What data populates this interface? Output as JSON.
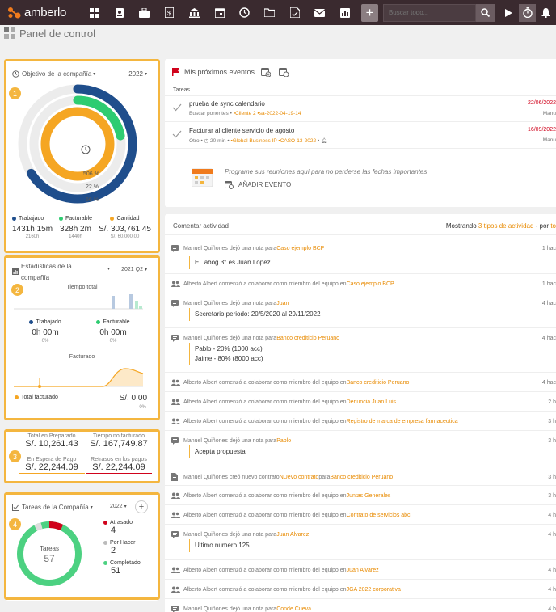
{
  "app": {
    "logo": "amberlo"
  },
  "topbar": {
    "search_placeholder": "Buscar todo...",
    "plus": "+",
    "icons": [
      "dashboard-icon",
      "contacts-icon",
      "briefcase-icon",
      "billing-icon",
      "bank-icon",
      "calendar-icon",
      "history-icon",
      "folder-icon",
      "document-icon",
      "mail-icon",
      "chart-icon"
    ]
  },
  "page": {
    "title": "Panel de control"
  },
  "objetivo": {
    "title": "Objetivo de la compañía",
    "year": "2022",
    "center_label": "",
    "pct": [
      "506 %",
      "22 %",
      "66 %"
    ],
    "legend": [
      {
        "label": "Trabajado",
        "value": "1431h 15m",
        "sub": "2160h",
        "color": "#1f4e8c"
      },
      {
        "label": "Facturable",
        "value": "328h 2m",
        "sub": "1440h",
        "color": "#2ecc71"
      },
      {
        "label": "Cantidad",
        "value": "S/. 303,761.45",
        "sub": "S/. 60,000.00",
        "color": "#f5a623"
      }
    ],
    "rings": {
      "trabajado": 0.66,
      "facturable": 0.22,
      "cantidad": 1.0
    }
  },
  "estadisticas": {
    "title_l1": "Estadísticas de la",
    "title_l2": "compañía",
    "period": "2021 Q2",
    "tiempo_total": "Tiempo total",
    "trabajado_label": "Trabajado",
    "trabajado_value": "0h 00m",
    "trabajado_pct": "0%",
    "facturable_label": "Facturable",
    "facturable_value": "0h 00m",
    "facturable_pct": "0%",
    "facturado": "Facturado",
    "total_facturado_label": "Total facturado",
    "total_facturado_value": "S/. 0.00",
    "total_facturado_pct": "0%"
  },
  "totales": [
    {
      "label": "Total en Preparado",
      "value": "S/. 10,261.43",
      "color": "#1f4e8c"
    },
    {
      "label": "Tiempo no facturado",
      "value": "S/. 167,749.87",
      "color": "#888"
    },
    {
      "label": "En Espera de Pago",
      "value": "S/. 22,244.09",
      "color": "#f5a623"
    },
    {
      "label": "Retrasos en los pagos",
      "value": "S/. 22,244.09",
      "color": "#d0021b"
    }
  ],
  "tareas": {
    "title": "Tareas de la Compañía",
    "year": "2022",
    "plus": "+",
    "center_label": "Tareas",
    "center_value": "57",
    "legend": [
      {
        "label": "Atrasado",
        "value": "4",
        "color": "#d0021b"
      },
      {
        "label": "Por Hacer",
        "value": "2",
        "color": "#bbb"
      },
      {
        "label": "Completado",
        "value": "51",
        "color": "#4cd181"
      }
    ]
  },
  "eventos": {
    "title": "Mis próximos eventos",
    "section": "Tareas",
    "items": [
      {
        "title": "prueba de sync calendario",
        "meta": "Buscar ponentes",
        "tag1": "Cliente 2",
        "tag2": "sa-2022-04-19-14",
        "date": "22/06/2022",
        "who": "Manu"
      },
      {
        "title": "Facturar al cliente servicio de agosto",
        "meta": "Otro",
        "dur": "20 min",
        "tag1": "Global Business IP",
        "tag2": "CASO-13-2022",
        "date": "16/09/2022",
        "who": "Manu"
      }
    ],
    "empty_text": "Programe sus reuniones aquí para no perderse las fechas importantes",
    "add_event": "AÑADIR EVENTO"
  },
  "actividad": {
    "title": "Comentar actividad",
    "showing_prefix": "Mostrando ",
    "showing_link": "3 tipos de actividad",
    "showing_suffix": " - por ",
    "showing_tail": "to",
    "rows": [
      {
        "pre": "Manuel Quiñones dejó una nota para ",
        "link": "Caso ejemplo BCP",
        "time": "1 hac",
        "icon": "note-icon"
      },
      {
        "pre": "Alberto Albert comenzó a colaborar como miembro del equipo en ",
        "link": "Caso ejemplo BCP",
        "time": "1 hac",
        "icon": "team-icon"
      },
      {
        "pre": "Manuel Quiñones dejó una nota para ",
        "link": "Juan",
        "time": "4 hac",
        "icon": "note-icon"
      },
      {
        "pre": "Manuel Quiñones dejó una nota para ",
        "link": "Banco crediticio Peruano",
        "time": "4 hac",
        "icon": "note-icon"
      },
      {
        "pre": "Alberto Albert comenzó a colaborar como miembro del equipo en ",
        "link": "Banco crediticio Peruano",
        "time": "4 hac",
        "icon": "team-icon"
      },
      {
        "pre": "Alberto Albert comenzó a colaborar como miembro del equipo en ",
        "link": "Denuncia Juan Luis",
        "time": "2 h",
        "icon": "team-icon"
      },
      {
        "pre": "Alberto Albert comenzó a colaborar como miembro del equipo en ",
        "link": "Registro de marca de empresa farmaceutica",
        "time": "3 h",
        "icon": "team-icon"
      },
      {
        "pre": "Manuel Quiñones dejó una nota para ",
        "link": "Pablo",
        "time": "3 h",
        "icon": "note-icon"
      },
      {
        "pre": "Manuel Quiñones creó nuevo contrato ",
        "link": "NUevo contrato",
        "mid": " para ",
        "link2": "Banco crediticio Peruano",
        "time": "3 h",
        "icon": "contract-icon"
      },
      {
        "pre": "Alberto Albert comenzó a colaborar como miembro del equipo en ",
        "link": "Juntas Generales",
        "time": "3 h",
        "icon": "team-icon"
      },
      {
        "pre": "Alberto Albert comenzó a colaborar como miembro del equipo en ",
        "link": "Contrato de servicios abc",
        "time": "4 h",
        "icon": "team-icon"
      },
      {
        "pre": "Manuel Quiñones dejó una nota para ",
        "link": "Juan Alvarez",
        "time": "4 h",
        "icon": "note-icon"
      },
      {
        "pre": "Alberto Albert comenzó a colaborar como miembro del equipo en ",
        "link": "Juan Alvarez",
        "time": "4 h",
        "icon": "team-icon"
      },
      {
        "pre": "Alberto Albert comenzó a colaborar como miembro del equipo en ",
        "link": "JGA 2022 corporativa",
        "time": "4 h",
        "icon": "team-icon"
      },
      {
        "pre": "Manuel Quiñones dejó una nota para ",
        "link": "Conde Cueva",
        "time": "4 h",
        "icon": "note-icon"
      }
    ],
    "notes": [
      {
        "lines": [
          "EL abog 3° es Juan Lopez"
        ]
      },
      {
        "lines": [
          "Secretario periodo: 20/5/2020 al 29/11/2022"
        ]
      },
      {
        "lines": [
          "Pablo - 20% (1000 acc)",
          "Jaime - 80% (8000 acc)"
        ]
      },
      {
        "lines": [
          "Acepta propuesta"
        ]
      },
      {
        "lines": [
          "Ultimo numero 125"
        ]
      }
    ]
  },
  "badges": [
    "1",
    "2",
    "3",
    "4"
  ]
}
